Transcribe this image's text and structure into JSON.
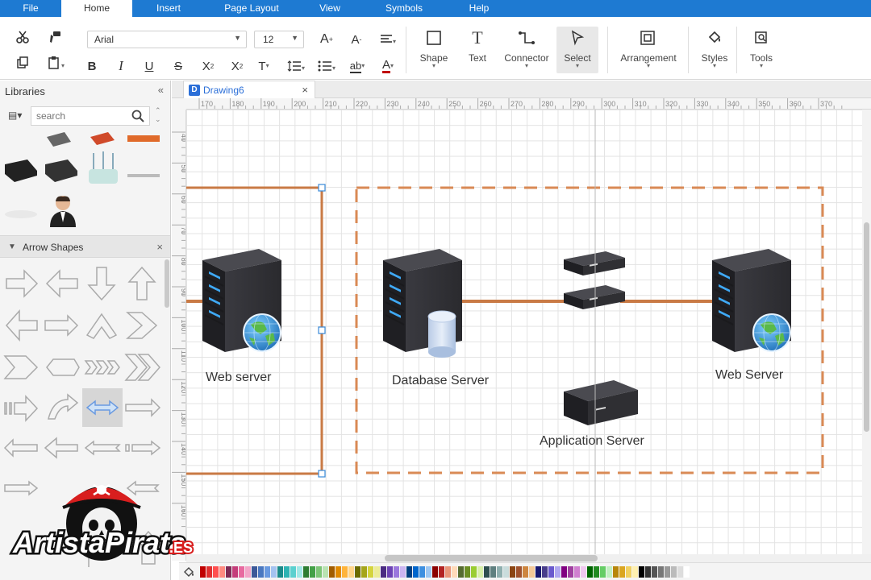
{
  "menubar": {
    "tabs": [
      {
        "label": "File",
        "active": false
      },
      {
        "label": "Home",
        "active": true
      },
      {
        "label": "Insert",
        "active": false
      },
      {
        "label": "Page Layout",
        "active": false
      },
      {
        "label": "View",
        "active": false
      },
      {
        "label": "Symbols",
        "active": false
      },
      {
        "label": "Help",
        "active": false
      }
    ]
  },
  "ribbon": {
    "font_family": "Arial",
    "font_size": "12",
    "tools": {
      "shape": "Shape",
      "text": "Text",
      "connector": "Connector",
      "select": "Select",
      "arrangement": "Arrangement",
      "styles": "Styles",
      "tools": "Tools"
    },
    "icons": [
      "cut-icon",
      "format-painter-icon",
      "copy-icon",
      "paste-icon",
      "bold-icon",
      "italic-icon",
      "underline-icon",
      "strikethrough-icon",
      "superscript-icon",
      "subscript-icon",
      "text-direction-icon",
      "line-spacing-icon",
      "list-icon",
      "highlight-icon",
      "font-color-icon",
      "grow-font-icon",
      "shrink-font-icon",
      "align-icon"
    ]
  },
  "sidebar": {
    "title": "Libraries",
    "search_placeholder": "search",
    "section_title": "Arrow Shapes"
  },
  "document": {
    "tab_label": "Drawing6",
    "tab_icon_letter": "D"
  },
  "rulers": {
    "horizontal": [
      "170",
      "180",
      "190",
      "200",
      "210",
      "220",
      "230",
      "240",
      "250",
      "260",
      "270",
      "280",
      "290",
      "300",
      "310",
      "320",
      "330",
      "340",
      "350",
      "360",
      "370"
    ],
    "vertical": [
      "40",
      "50",
      "60",
      "70",
      "80",
      "90",
      "100",
      "110",
      "120",
      "130",
      "140",
      "150",
      "160"
    ]
  },
  "diagram": {
    "labels": {
      "web_server_left": "Web server",
      "database_server": "Database Server",
      "web_server_right": "Web Server",
      "application_server": "Application Server"
    },
    "colors": {
      "connector": "#c97a45",
      "dashed_border": "#d98a55",
      "server_dark": "#2f2f33",
      "server_led": "#3fa9f5"
    }
  },
  "palette": {
    "colors": [
      "#c00000",
      "#e03030",
      "#ff5050",
      "#ff8a80",
      "#7f2a55",
      "#c43e7a",
      "#e86aa0",
      "#f3a5c8",
      "#3b5998",
      "#4a78c0",
      "#6a9ae0",
      "#a4c3f0",
      "#1b8a8a",
      "#2fb3b3",
      "#5ad0cf",
      "#a0e8e6",
      "#2e7d32",
      "#43a047",
      "#7cc576",
      "#b9e3b2",
      "#a15c00",
      "#e08a00",
      "#ffb43a",
      "#ffd58a",
      "#6b6b00",
      "#a5a51a",
      "#d4d43c",
      "#ecec96",
      "#4b2c82",
      "#6d44b5",
      "#9b78dd",
      "#cbb5f1",
      "#003f7f",
      "#0066cc",
      "#3d8fe0",
      "#9cc6f2",
      "#8b0000",
      "#b22222",
      "#e9967a",
      "#ffdab9",
      "#556b2f",
      "#6b8e23",
      "#9acd32",
      "#d8f0a8",
      "#2f4f4f",
      "#5f7f7f",
      "#8fafaf",
      "#c9dcdc",
      "#8b4513",
      "#a0522d",
      "#cd853f",
      "#f4c998",
      "#191970",
      "#483d8b",
      "#6a5acd",
      "#b0a8f0",
      "#800080",
      "#a040a0",
      "#d080d0",
      "#f0c8f0",
      "#006400",
      "#228b22",
      "#66cd66",
      "#c1f0c1",
      "#b8860b",
      "#daa520",
      "#f0d060",
      "#fff0b0",
      "#000000",
      "#333333",
      "#555555",
      "#777777",
      "#999999",
      "#bbbbbb",
      "#dddddd",
      "#ffffff"
    ]
  },
  "logo": {
    "text": "ArtistaPirata",
    "suffix": ".ES"
  }
}
